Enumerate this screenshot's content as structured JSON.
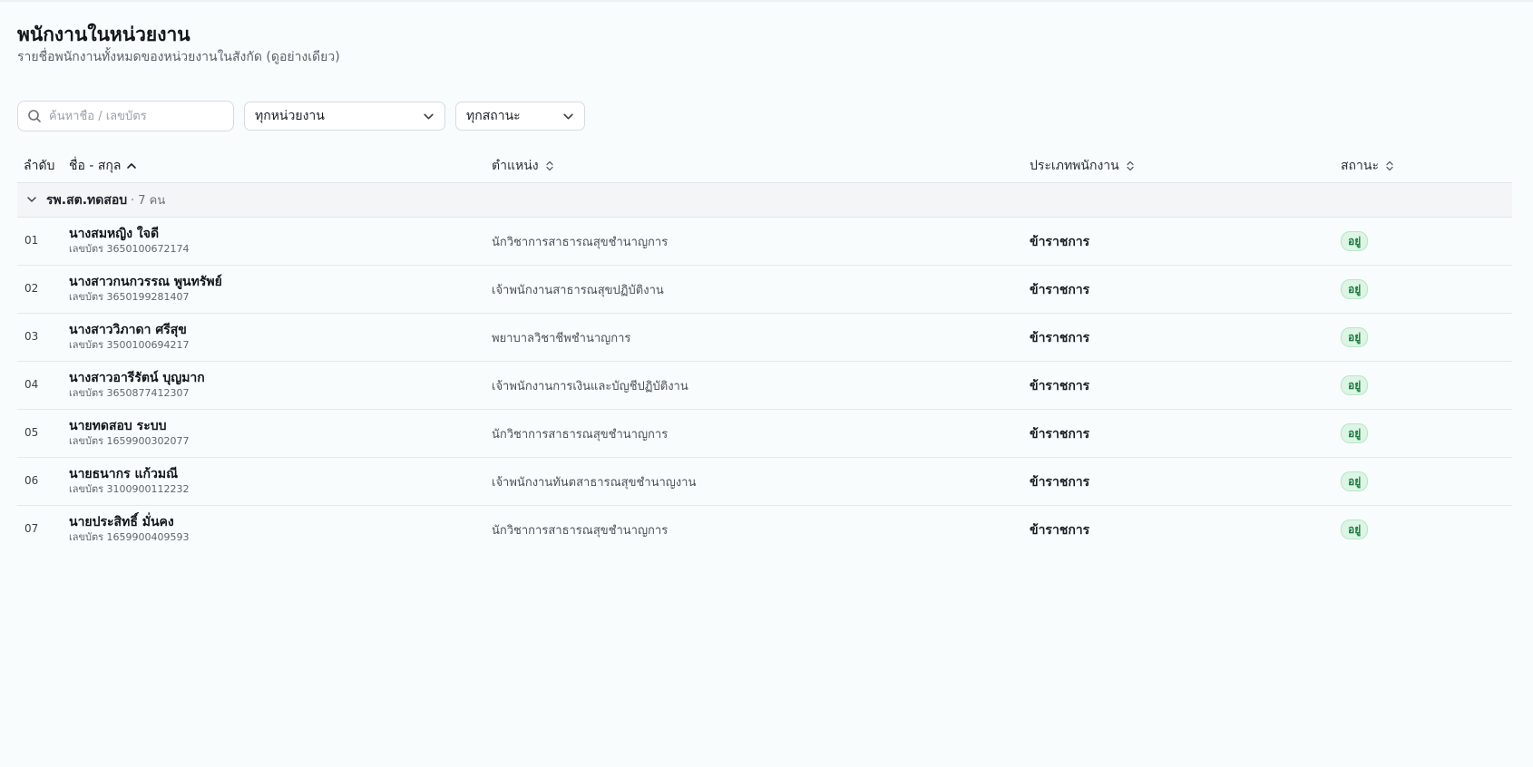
{
  "header": {
    "title": "พนักงานในหน่วยงาน",
    "subtitle": "รายชื่อพนักงานทั้งหมดของหน่วยงานในสังกัด (ดูอย่างเดียว)"
  },
  "filters": {
    "search_placeholder": "ค้นหาชื่อ / เลขบัตร",
    "unit_selected": "ทุกหน่วยงาน",
    "status_selected": "ทุกสถานะ"
  },
  "columns": {
    "no": "ลำดับ",
    "name": "ชื่อ - สกุล",
    "position": "ตำแหน่ง",
    "type": "ประเภทพนักงาน",
    "status": "สถานะ"
  },
  "group": {
    "name": "รพ.สต.ทดสอบ",
    "count": "· 7 คน"
  },
  "rows": [
    {
      "no": "01",
      "name": "นางสมหญิง ใจดี",
      "id": "เลขบัตร 3650100672174",
      "position": "นักวิชาการสาธารณสุขชำนาญการ",
      "type": "ข้าราชการ",
      "status": "อยู่"
    },
    {
      "no": "02",
      "name": "นางสาวกนกวรรณ พูนทรัพย์",
      "id": "เลขบัตร 3650199281407",
      "position": "เจ้าพนักงานสาธารณสุขปฏิบัติงาน",
      "type": "ข้าราชการ",
      "status": "อยู่"
    },
    {
      "no": "03",
      "name": "นางสาววิภาดา ศรีสุข",
      "id": "เลขบัตร 3500100694217",
      "position": "พยาบาลวิชาชีพชำนาญการ",
      "type": "ข้าราชการ",
      "status": "อยู่"
    },
    {
      "no": "04",
      "name": "นางสาวอารีรัตน์ บุญมาก",
      "id": "เลขบัตร 3650877412307",
      "position": "เจ้าพนักงานการเงินและบัญชีปฏิบัติงาน",
      "type": "ข้าราชการ",
      "status": "อยู่"
    },
    {
      "no": "05",
      "name": "นายทดสอบ ระบบ",
      "id": "เลขบัตร 1659900302077",
      "position": "นักวิชาการสาธารณสุขชำนาญการ",
      "type": "ข้าราชการ",
      "status": "อยู่"
    },
    {
      "no": "06",
      "name": "นายธนากร แก้วมณี",
      "id": "เลขบัตร 3100900112232",
      "position": "เจ้าพนักงานทันตสาธารณสุขชำนาญงาน",
      "type": "ข้าราชการ",
      "status": "อยู่"
    },
    {
      "no": "07",
      "name": "นายประสิทธิ์ มั่นคง",
      "id": "เลขบัตร 1659900409593",
      "position": "นักวิชาการสาธารณสุขชำนาญการ",
      "type": "ข้าราชการ",
      "status": "อยู่"
    }
  ]
}
